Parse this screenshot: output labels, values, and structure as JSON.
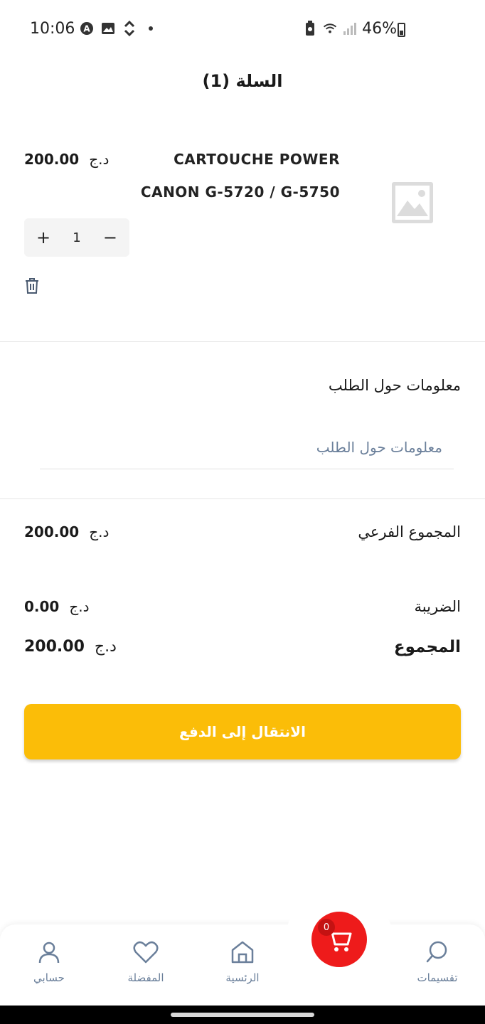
{
  "status_bar": {
    "time": "10:06",
    "battery": "46%",
    "left_icons": [
      "a-circle-icon",
      "image-icon",
      "sync-icon",
      "dot-icon"
    ],
    "right_icons": [
      "battery-saver-icon",
      "wifi-icon",
      "signal-icon"
    ]
  },
  "header": {
    "title": "السلة (1)"
  },
  "cart_item": {
    "name_line1": "CARTOUCHE POWER",
    "name_line2": "CANON G-5720 / G-5750",
    "price": "200.00",
    "currency": "د.ج",
    "quantity": "1",
    "increment": "+",
    "decrement": "−"
  },
  "order_info": {
    "title": "معلومات حول الطلب",
    "placeholder": "معلومات حول الطلب"
  },
  "summary": {
    "subtotal_label": "المجموع الفرعي",
    "subtotal_value": "200.00",
    "tax_label": "الضريبة",
    "tax_value": "0.00",
    "total_label": "المجموع",
    "total_value": "200.00",
    "currency": "د.ج"
  },
  "checkout": {
    "label": "الانتقال إلى الدفع"
  },
  "bottom_nav": {
    "account": "حسابي",
    "favorites": "المفضلة",
    "home": "الرئسية",
    "cart_count": "0",
    "categories": "تقسيمات"
  },
  "colors": {
    "accent": "#fbbd08",
    "cart_fab": "#ee1b1b",
    "nav_text": "#6a7f9a"
  }
}
